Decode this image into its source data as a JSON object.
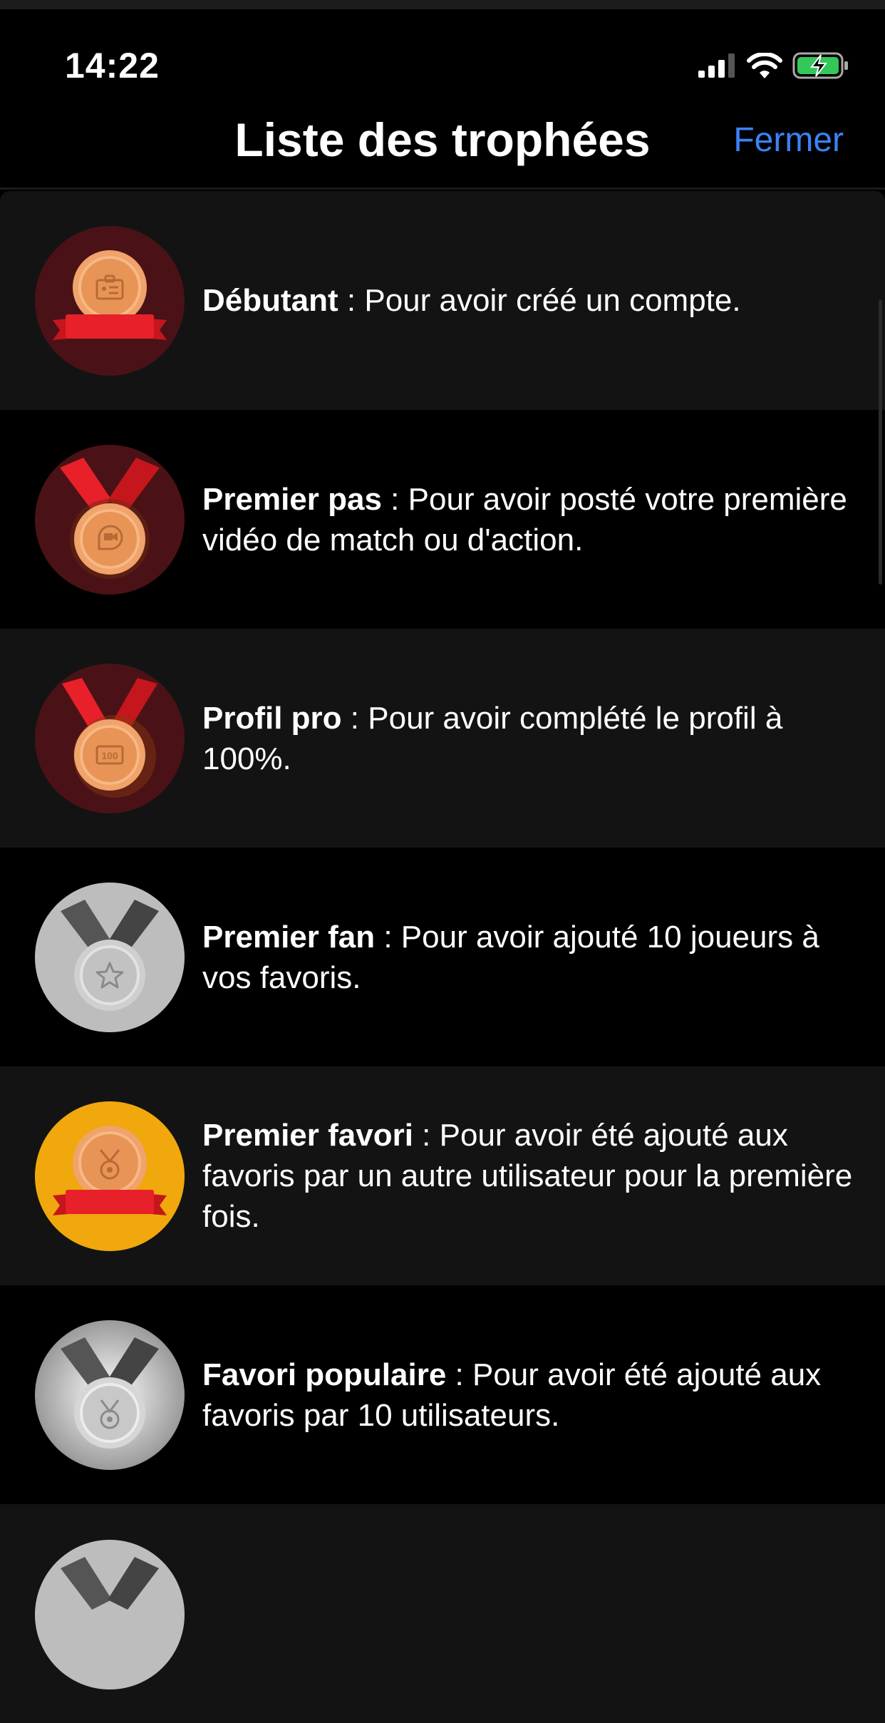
{
  "status_bar": {
    "time": "14:22",
    "icons": [
      "signal-icon",
      "wifi-icon",
      "battery-charging-icon"
    ]
  },
  "header": {
    "title": "Liste des trophées",
    "close_label": "Fermer",
    "accent_color": "#3b82f6"
  },
  "trophies": [
    {
      "name": "Débutant",
      "separator": " : ",
      "description": "Pour avoir créé un compte.",
      "medal": "bronze-banner-id-card",
      "background": "dark-red"
    },
    {
      "name": "Premier pas",
      "separator": " : ",
      "description": "Pour avoir posté votre première vidéo de match ou d'action.",
      "medal": "bronze-ribbon-video",
      "background": "dark-red"
    },
    {
      "name": "Profil pro",
      "separator": " : ",
      "description": "Pour avoir complété le profil à 100%.",
      "medal": "bronze-ribbon-100",
      "background": "dark-red"
    },
    {
      "name": "Premier fan",
      "separator": " : ",
      "description": "Pour avoir ajouté 10 joueurs à vos favoris.",
      "medal": "silver-ribbon-star",
      "background": "gray"
    },
    {
      "name": "Premier favori",
      "separator": " : ",
      "description": "Pour avoir été ajouté aux favoris par un autre utilisateur pour la première fois.",
      "medal": "bronze-banner-award",
      "background": "gold"
    },
    {
      "name": "Favori populaire",
      "separator": " : ",
      "description": "Pour avoir été ajouté aux favoris par 10 utilisateurs.",
      "medal": "silver-ribbon-award",
      "background": "silver"
    }
  ]
}
